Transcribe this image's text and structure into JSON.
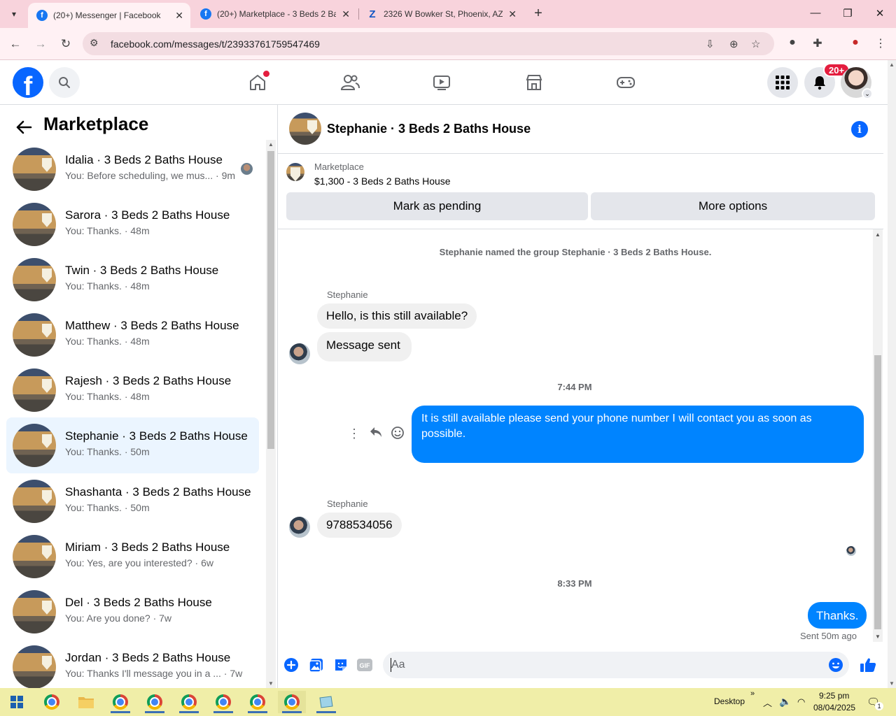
{
  "browser": {
    "tabs": [
      {
        "title": "(20+) Messenger | Facebook",
        "active": true
      },
      {
        "title": "(20+) Marketplace - 3 Beds 2 Baths",
        "active": false
      },
      {
        "title": "2326 W Bowker St, Phoenix, AZ",
        "active": false
      }
    ],
    "url": "facebook.com/messages/t/23933761759547469"
  },
  "fb_header": {
    "logo": "f",
    "notification_badge": "20+"
  },
  "left_panel": {
    "title": "Marketplace",
    "conversations": [
      {
        "name": "Idalia · 3 Beds 2 Baths House",
        "snippet": "You: Before scheduling, we mus... · 9m",
        "selected": false
      },
      {
        "name": "Sarora · 3 Beds 2 Baths House",
        "snippet": "You: Thanks. · 48m",
        "selected": false
      },
      {
        "name": "Twin · 3 Beds 2 Baths House",
        "snippet": "You: Thanks. · 48m",
        "selected": false
      },
      {
        "name": "Matthew · 3 Beds 2 Baths House",
        "snippet": "You: Thanks. · 48m",
        "selected": false
      },
      {
        "name": "Rajesh · 3 Beds 2 Baths House",
        "snippet": "You: Thanks. · 48m",
        "selected": false
      },
      {
        "name": "Stephanie · 3 Beds 2 Baths House",
        "snippet": "You: Thanks. · 50m",
        "selected": true
      },
      {
        "name": "Shashanta · 3 Beds 2 Baths House",
        "snippet": "You: Thanks. · 50m",
        "selected": false
      },
      {
        "name": "Miriam · 3 Beds 2 Baths House",
        "snippet": "You: Yes, are you interested? · 6w",
        "selected": false
      },
      {
        "name": "Del · 3 Beds 2 Baths House",
        "snippet": "You: Are you done? · 7w",
        "selected": false
      },
      {
        "name": "Jordan · 3 Beds 2 Baths House",
        "snippet": "You: Thanks I'll message you in a ... · 7w",
        "selected": false
      }
    ]
  },
  "chat": {
    "title": "Stephanie · 3 Beds 2 Baths House",
    "listing": {
      "label": "Marketplace",
      "price_title": "$1,300 - 3 Beds 2 Baths House",
      "pending_button": "Mark as pending",
      "options_button": "More options"
    },
    "system_message": "Stephanie named the group Stephanie · 3 Beds 2 Baths House.",
    "sender_1": "Stephanie",
    "msg_1": "Hello, is this still available?",
    "msg_2": "Message sent",
    "time_1": "7:44 PM",
    "out_1": "It is still available please send your phone number I will contact you as soon as possible.",
    "sender_2": "Stephanie",
    "msg_3": "9788534056",
    "time_2": "8:33 PM",
    "out_2": "Thanks.",
    "sent_status": "Sent 50m ago",
    "composer_placeholder": "Aa"
  },
  "taskbar": {
    "desktop_label": "Desktop",
    "time": "9:25 pm",
    "date": "08/04/2025",
    "notification_count": "1"
  },
  "colors": {
    "fb_blue": "#0866ff",
    "messenger_blue": "#0084ff",
    "selected_bg": "#ebf5ff",
    "badge_red": "#e41e3f"
  }
}
